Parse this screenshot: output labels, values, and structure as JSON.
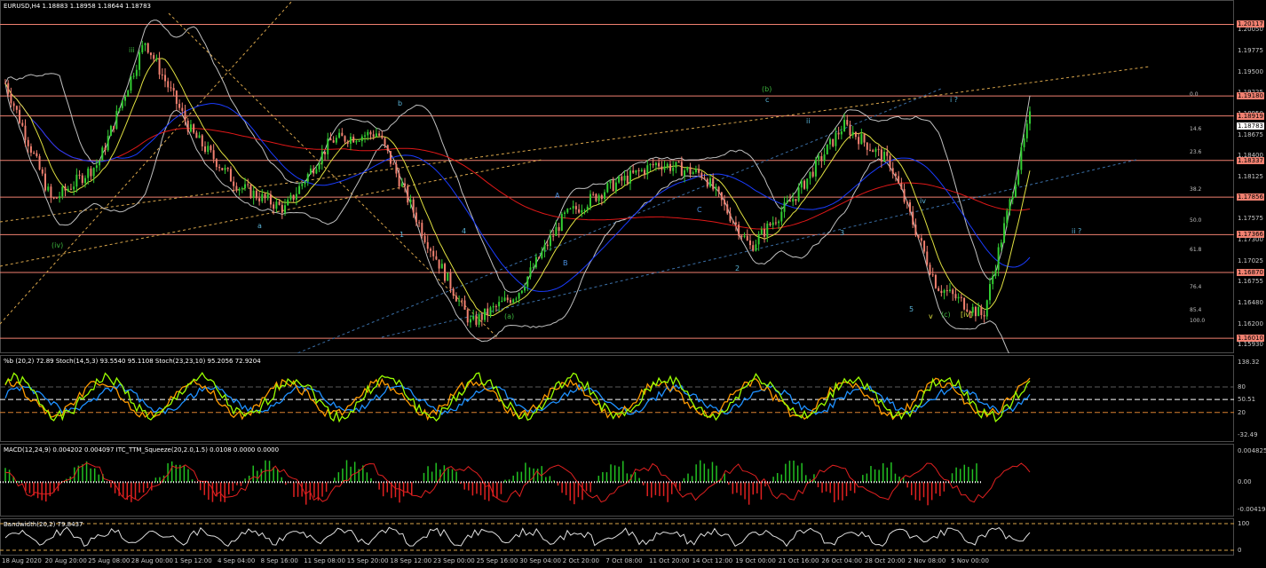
{
  "window": {
    "symbol_header": "EURUSD,H4  1.18883 1.18958 1.18644 1.18783",
    "indicator1_header": "%b (20,2) 72.89  Stoch(14,5,3) 93.5540 95.1108  Stoch(23,23,10) 95.2056 72.9204",
    "indicator2_header": "MACD(12,24,9) 0.004202 0.004097  ITC_TTM_Squeeze(20,2.0,1.5) 0.0108 0.0000 0.0000",
    "indicator3_header": "Bandwidth(20,2) 79.8437"
  },
  "colors": {
    "background": "#000000",
    "bull_candle": "#32cd32",
    "bear_candle": "#f08070",
    "level_line": "#f08070",
    "bollinger": "#c0c0c0",
    "ma_red": "#e01818",
    "ma_blue": "#1a3cff",
    "ma_yellow": "#e0e040",
    "stoch_green": "#9aff00",
    "stoch_orange": "#ff9a00",
    "stoch_blue": "#1e90ff",
    "macd_hist_up": "#22c022",
    "macd_hist_down": "#e02020",
    "bandwidth_line": "#e0e0e0",
    "channel_orange": "#d7a44a"
  },
  "price_axis": {
    "ticks": [
      "1.20050",
      "1.19775",
      "1.19500",
      "1.19225",
      "1.18950",
      "1.18675",
      "1.18400",
      "1.18125",
      "1.17850",
      "1.17575",
      "1.17300",
      "1.17025",
      "1.16755",
      "1.16480",
      "1.16200",
      "1.15930"
    ],
    "levels": [
      {
        "label": "1.20117",
        "value": 1.20117
      },
      {
        "label": "1.19180",
        "value": 1.1918
      },
      {
        "label": "1.18919",
        "value": 1.18919
      },
      {
        "label": "1.18337",
        "value": 1.18337
      },
      {
        "label": "1.17856",
        "value": 1.17856
      },
      {
        "label": "1.17366",
        "value": 1.17366
      },
      {
        "label": "1.16870",
        "value": 1.1687
      },
      {
        "label": "1.16010",
        "value": 1.1601
      }
    ],
    "current_price": "1.18783"
  },
  "fib_labels": [
    "0.0",
    "14.6",
    "23.6",
    "38.2",
    "50.0",
    "61.8",
    "76.4",
    "85.4",
    "100.0"
  ],
  "wave_labels": [
    "(iv)",
    "iii",
    "a",
    "b",
    "c",
    "A",
    "B",
    "C",
    "1",
    "2",
    "3",
    "4",
    "5",
    "(a)",
    "(b)",
    "(c)",
    "ii",
    "iv",
    "v",
    "i ?",
    "ii ?",
    "[iv]"
  ],
  "indicator1_axis": {
    "ticks": [
      "138.32",
      "80",
      "50.51",
      "20",
      "-32.49"
    ]
  },
  "indicator2_axis": {
    "ticks": [
      "0.004825",
      "0.00",
      "-0.004194"
    ]
  },
  "indicator3_axis": {
    "ticks": [
      "100",
      "0"
    ]
  },
  "time_axis": [
    "18 Aug 2020",
    "20 Aug 20:00",
    "25 Aug 08:00",
    "28 Aug 00:00",
    "1 Sep 12:00",
    "4 Sep 04:00",
    "8 Sep 16:00",
    "11 Sep 08:00",
    "15 Sep 20:00",
    "18 Sep 12:00",
    "23 Sep 00:00",
    "25 Sep 16:00",
    "30 Sep 04:00",
    "2 Oct 20:00",
    "7 Oct 08:00",
    "11 Oct 20:00",
    "14 Oct 12:00",
    "19 Oct 00:00",
    "21 Oct 16:00",
    "26 Oct 04:00",
    "28 Oct 20:00",
    "2 Nov 08:00",
    "5 Nov 00:00"
  ],
  "chart_data": {
    "type": "line",
    "title": "EURUSD,H4",
    "x": [
      "18 Aug 2020",
      "20 Aug 20:00",
      "25 Aug 08:00",
      "28 Aug 00:00",
      "1 Sep 12:00",
      "4 Sep 04:00",
      "8 Sep 16:00",
      "11 Sep 08:00",
      "15 Sep 20:00",
      "18 Sep 12:00",
      "23 Sep 00:00",
      "25 Sep 16:00",
      "30 Sep 04:00",
      "2 Oct 20:00",
      "7 Oct 08:00",
      "11 Oct 20:00",
      "14 Oct 12:00",
      "19 Oct 00:00",
      "21 Oct 16:00",
      "26 Oct 04:00",
      "28 Oct 20:00",
      "2 Nov 08:00",
      "5 Nov 00:00"
    ],
    "ylim": [
      1.1593,
      1.2032
    ],
    "series": [
      {
        "values": [
          1.1935,
          1.178,
          1.183,
          1.199,
          1.187,
          1.18,
          1.177,
          1.186,
          1.187,
          1.1735,
          1.162,
          1.166,
          1.176,
          1.18,
          1.183,
          1.1815,
          1.172,
          1.179,
          1.188,
          1.183,
          1.167,
          1.163,
          1.189
        ]
      }
    ]
  }
}
